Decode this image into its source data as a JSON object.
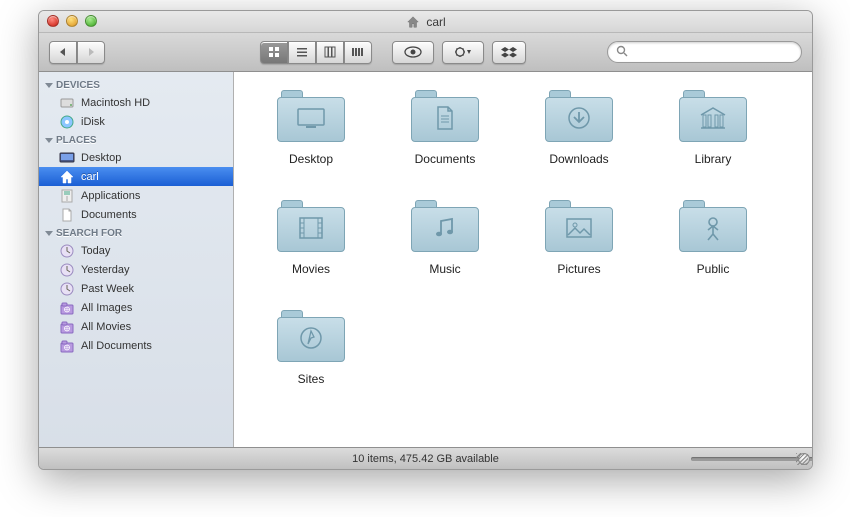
{
  "window": {
    "title": "carl"
  },
  "sidebar": {
    "sections": [
      {
        "label": "DEVICES",
        "items": [
          {
            "label": "Macintosh HD",
            "icon": "hdd"
          },
          {
            "label": "iDisk",
            "icon": "idisk"
          }
        ]
      },
      {
        "label": "PLACES",
        "items": [
          {
            "label": "Desktop",
            "icon": "desktop"
          },
          {
            "label": "carl",
            "icon": "home",
            "selected": true
          },
          {
            "label": "Applications",
            "icon": "apps"
          },
          {
            "label": "Documents",
            "icon": "doc"
          }
        ]
      },
      {
        "label": "SEARCH FOR",
        "items": [
          {
            "label": "Today",
            "icon": "clock"
          },
          {
            "label": "Yesterday",
            "icon": "clock"
          },
          {
            "label": "Past Week",
            "icon": "clock"
          },
          {
            "label": "All Images",
            "icon": "smart"
          },
          {
            "label": "All Movies",
            "icon": "smart"
          },
          {
            "label": "All Documents",
            "icon": "smart"
          }
        ]
      }
    ]
  },
  "folders": [
    {
      "name": "Desktop",
      "emblem": "desktop"
    },
    {
      "name": "Documents",
      "emblem": "doc"
    },
    {
      "name": "Downloads",
      "emblem": "download"
    },
    {
      "name": "Library",
      "emblem": "library"
    },
    {
      "name": "Movies",
      "emblem": "movie"
    },
    {
      "name": "Music",
      "emblem": "music"
    },
    {
      "name": "Pictures",
      "emblem": "picture"
    },
    {
      "name": "Public",
      "emblem": "public"
    },
    {
      "name": "Sites",
      "emblem": "sites"
    }
  ],
  "status": {
    "text": "10 items, 475.42 GB available"
  },
  "search": {
    "placeholder": ""
  }
}
